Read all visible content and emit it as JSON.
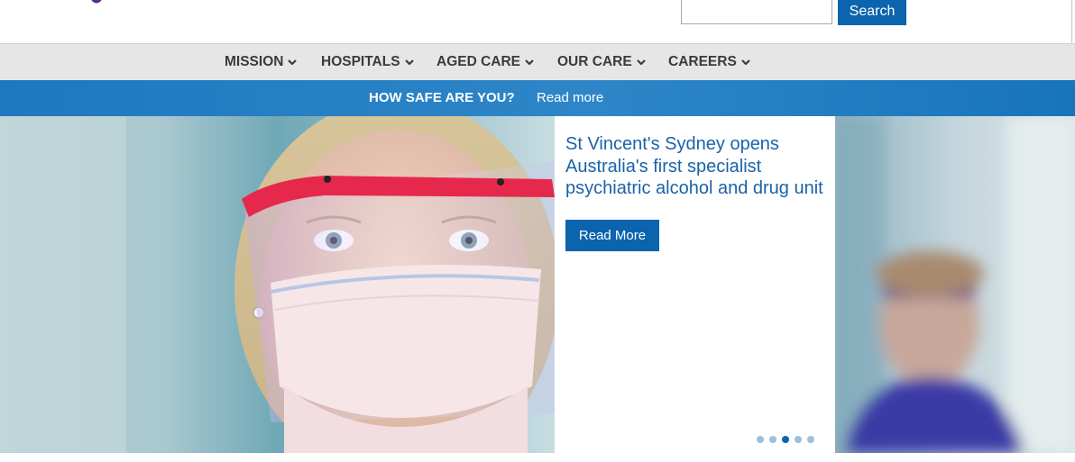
{
  "header": {
    "search": {
      "value": "",
      "placeholder": "",
      "button_label": "Search"
    }
  },
  "nav": {
    "items": [
      {
        "label": "MISSION",
        "icon": "chevron-down-icon"
      },
      {
        "label": "HOSPITALS",
        "icon": "chevron-down-icon"
      },
      {
        "label": "AGED CARE",
        "icon": "chevron-down-icon"
      },
      {
        "label": "OUR CARE",
        "icon": "chevron-down-icon"
      },
      {
        "label": "CAREERS",
        "icon": "chevron-down-icon"
      }
    ]
  },
  "alert": {
    "title": "HOW SAFE ARE YOU?",
    "link": "Read more"
  },
  "hero": {
    "headline": "St Vincent's Sydney opens Australia's first specialist psychiatric alcohol and drug unit",
    "button_label": "Read More",
    "slide_count": 5,
    "active_slide": 3
  },
  "colors": {
    "brand_blue": "#0b64ad",
    "headline_blue": "#1a63a8",
    "alert_blue": "#2e86c8",
    "nav_bg": "#e6e6e6",
    "logo_purple": "#5b2d8c"
  }
}
